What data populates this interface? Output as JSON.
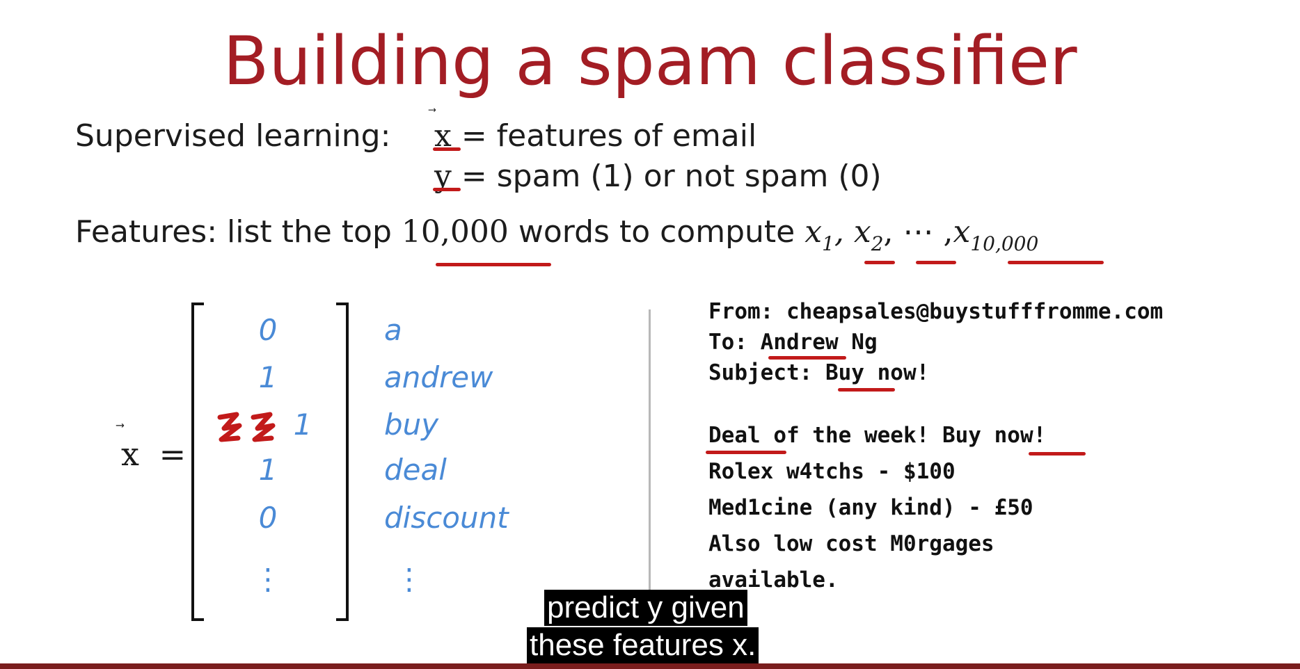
{
  "slide": {
    "title": "Building a spam classifier",
    "supervised_prefix": "Supervised learning:",
    "x_symbol": "x",
    "x_def": "= features of email",
    "y_symbol": "y",
    "y_def": "= spam (1) or not spam (0)",
    "features_prefix": "Features: list the top",
    "features_count": "10,000",
    "features_mid": "words to compute",
    "x1": "x",
    "x1_sub": "1",
    "x2": "x",
    "x2_sub": "2",
    "ellipsis": ", ⋯ ,",
    "xn": "x",
    "xn_sub": "10,000",
    "vector_label": "x",
    "equals": "=",
    "vector_values": [
      "0",
      "1",
      "1",
      "1",
      "0",
      "⋮"
    ],
    "vector_words": [
      "a",
      "andrew",
      "buy",
      "deal",
      "discount",
      "⋮"
    ]
  },
  "email": {
    "from": "From: cheapsales@buystufffromme.com",
    "to_prefix": "To: ",
    "to_name": "Andrew",
    "to_suffix": " Ng",
    "subject_prefix": "Subject: ",
    "subject_buy": "Buy",
    "subject_suffix": " now!",
    "body_deal": "Deal",
    "body_mid": " of the week! ",
    "body_buy": "Buy",
    "body_end": " now!",
    "line2": "Rolex w4tchs - $100",
    "line3": "Med1cine (any kind) - £50",
    "line4": "Also low cost M0rgages",
    "line5": "available."
  },
  "captions": {
    "line1": "predict y given",
    "line2": "these features x."
  },
  "colors": {
    "title": "#a31d24",
    "annotation_red": "#c21a1a",
    "handwriting_blue": "#4a8ad6",
    "bottom_bar": "#7a1d1d"
  }
}
